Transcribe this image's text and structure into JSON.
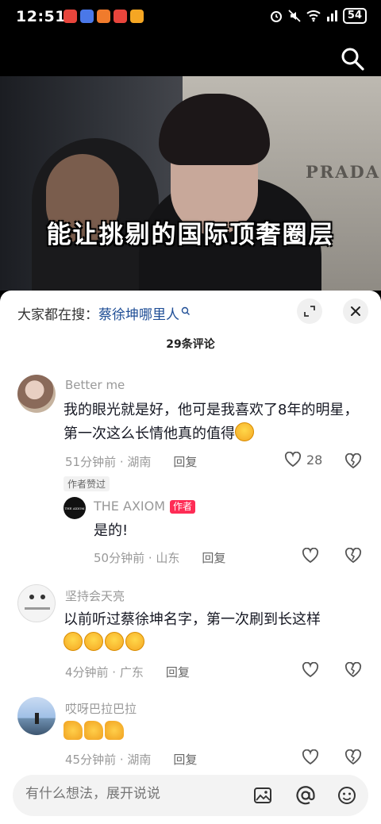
{
  "status_bar": {
    "time": "12:51",
    "battery": "54",
    "notification_colors": [
      "#e8453c",
      "#4a78e8",
      "#f07b2c",
      "#e8453c",
      "#f5a623"
    ]
  },
  "video": {
    "caption": "能让挑剔的国际顶奢圈层",
    "sign_text": "PRADA"
  },
  "sheet": {
    "search_prefix": "大家都在搜：",
    "search_term": "蔡徐坤哪里人",
    "comment_count": "29条评论"
  },
  "comments": [
    {
      "username": "Better me",
      "content": "我的眼光就是好，他可是我喜欢了8年的明星，第一次这么长情他真的值得",
      "time_location": "51分钟前 · 湖南",
      "reply_label": "回复",
      "likes": "28",
      "badge": "作者赞过"
    },
    {
      "username": "THE AXIOM",
      "author_tag": "作者",
      "content": "是的!",
      "time_location": "50分钟前 · 山东",
      "reply_label": "回复"
    },
    {
      "username": "坚持会天亮",
      "content": "以前听过蔡徐坤名字，第一次刷到长这样",
      "time_location": "4分钟前 · 广东",
      "reply_label": "回复"
    },
    {
      "username": "哎呀巴拉巴拉",
      "content": "",
      "time_location": "45分钟前 · 湖南",
      "reply_label": "回复"
    }
  ],
  "input": {
    "placeholder": "有什么想法，展开说说"
  },
  "colors": {
    "accent_red": "#fe2c55",
    "link_blue": "#1f4e96"
  }
}
